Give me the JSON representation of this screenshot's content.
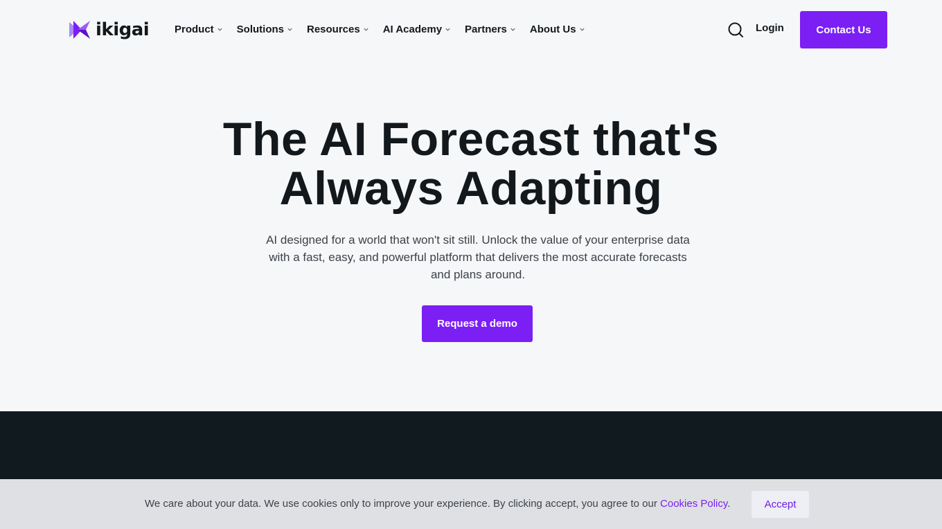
{
  "brand": {
    "name": "ikigai",
    "accent_color": "#7b1ff5",
    "logo_icon": "ikigai-logo-icon"
  },
  "nav": {
    "items": [
      {
        "label": "Product"
      },
      {
        "label": "Solutions"
      },
      {
        "label": "Resources"
      },
      {
        "label": "AI Academy"
      },
      {
        "label": "Partners"
      },
      {
        "label": "About Us"
      }
    ],
    "login_label": "Login",
    "contact_label": "Contact Us",
    "search_icon": "search-icon"
  },
  "hero": {
    "title_line1": "The AI Forecast that's",
    "title_line2": "Always Adapting",
    "subtitle": "AI designed for a world that won't sit still. Unlock the value of your enterprise data with a fast, easy, and powerful platform that delivers the most accurate forecasts and plans around.",
    "cta_label": "Request a demo"
  },
  "cookie_banner": {
    "text": "We care about your data. We use cookies only to improve your experience. By clicking accept, you agree to our",
    "link_label": "Cookies Policy",
    "period": ".",
    "accept_label": "Accept"
  },
  "colors": {
    "background": "#f6f7f9",
    "dark_section": "#111a1f",
    "cookie_bar": "#dfe0e3"
  }
}
